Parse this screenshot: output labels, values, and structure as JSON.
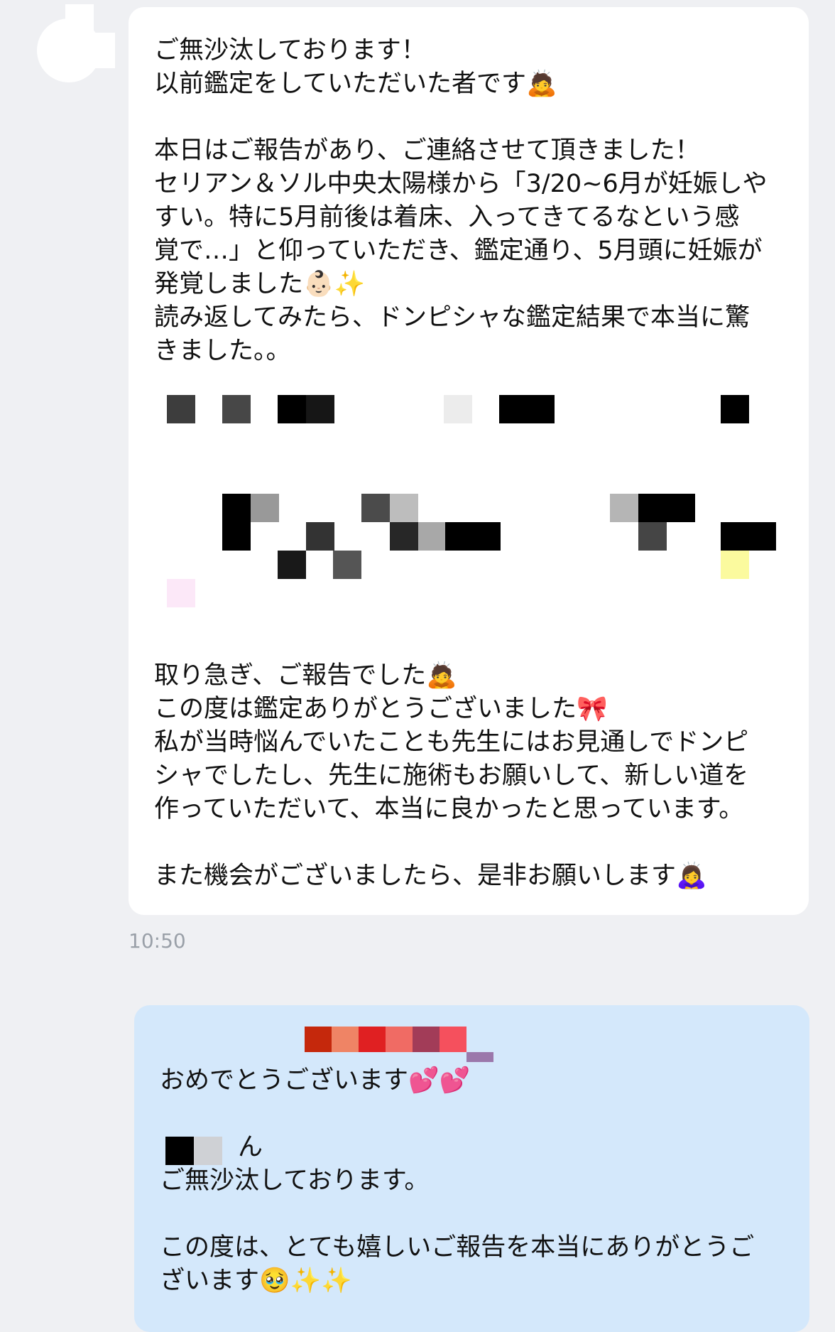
{
  "incoming": {
    "lines": [
      "ご無沙汰しております！",
      "以前鑑定をしていただいた者です🙇",
      "",
      "本日はご報告があり、ご連絡させて頂きました！",
      "セリアン＆ソル中央太陽様から「3/20~6月が妊娠しや",
      "すい。特に5月前後は着床、入ってきてるなという感",
      "覚で…」と仰っていただき、鑑定通り、5月頭に妊娠が",
      "発覚しました👶🏻✨",
      "読み返してみたら、ドンピシャな鑑定結果で本当に驚",
      "きました。。"
    ],
    "lines2": [
      "取り急ぎ、ご報告でした🙇",
      "この度は鑑定ありがとうございました🎀",
      "私が当時悩んでいたことも先生にはお見通しでドンピ",
      "シャでしたし、先生に施術もお願いして、新しい道を",
      "作っていただいて、本当に良かったと思っています。",
      "",
      "また機会がございましたら、是非お願いします🙇‍♀️"
    ],
    "time": "10:50"
  },
  "outgoing": {
    "lines": [
      "おめでとうございます💕💕",
      "",
      "ん",
      "ご無沙汰しております。",
      "",
      "この度は、とても嬉しいご報告を本当にありがとうご",
      "ざいます🥹✨✨"
    ]
  },
  "colors": {
    "background": "#eff0f3",
    "incoming_bubble": "#ffffff",
    "outgoing_bubble": "#d4e8fb",
    "timestamp": "#9aa0a8"
  }
}
